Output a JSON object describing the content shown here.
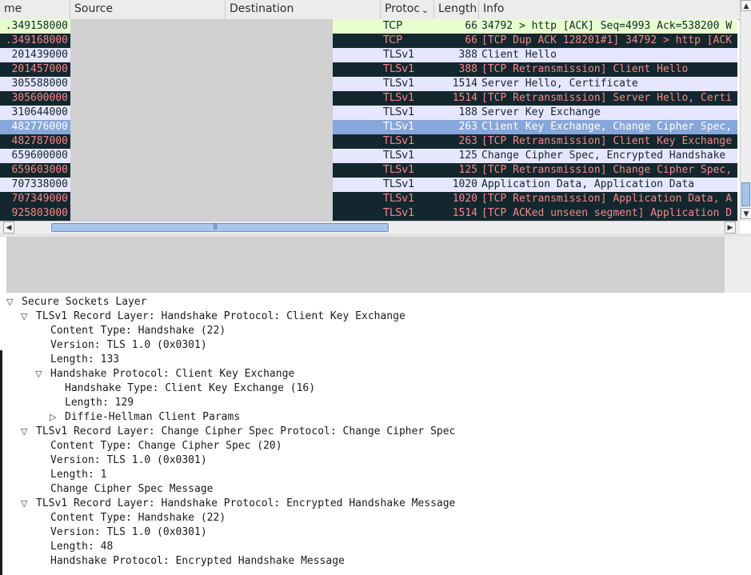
{
  "columns": [
    {
      "label": "me"
    },
    {
      "label": "Source"
    },
    {
      "label": "Destination"
    },
    {
      "label": "Protoc"
    },
    {
      "label": "Length"
    },
    {
      "label": "Info"
    }
  ],
  "packets": [
    {
      "time": ".349158000",
      "protocol": "TCP",
      "length": "66",
      "info": "34792 > http [ACK] Seq=4993 Ack=538200 W",
      "style": "tcp"
    },
    {
      "time": ".349168000",
      "protocol": "TCP",
      "length": "66",
      "info": "[TCP Dup ACK 128201#1] 34792 > http [ACK",
      "style": "tcpdup"
    },
    {
      "time": "201439000",
      "protocol": "TLSv1",
      "length": "388",
      "info": "Client Hello",
      "style": "tls"
    },
    {
      "time": "201457000",
      "protocol": "TLSv1",
      "length": "388",
      "info": "[TCP Retransmission] Client Hello",
      "style": "retrans"
    },
    {
      "time": "305588000",
      "protocol": "TLSv1",
      "length": "1514",
      "info": "Server Hello, Certificate",
      "style": "tls"
    },
    {
      "time": "305600000",
      "protocol": "TLSv1",
      "length": "1514",
      "info": "[TCP Retransmission] Server Hello, Certi",
      "style": "retrans"
    },
    {
      "time": "310644000",
      "protocol": "TLSv1",
      "length": "188",
      "info": "Server Key Exchange",
      "style": "tls"
    },
    {
      "time": "482776000",
      "protocol": "TLSv1",
      "length": "263",
      "info": "Client Key Exchange, Change Cipher Spec,",
      "style": "sel"
    },
    {
      "time": "482787000",
      "protocol": "TLSv1",
      "length": "263",
      "info": "[TCP Retransmission] Client Key Exchange",
      "style": "retrans"
    },
    {
      "time": "659600000",
      "protocol": "TLSv1",
      "length": "125",
      "info": "Change Cipher Spec, Encrypted Handshake",
      "style": "tls"
    },
    {
      "time": "659603000",
      "protocol": "TLSv1",
      "length": "125",
      "info": "[TCP Retransmission] Change Cipher Spec,",
      "style": "retrans"
    },
    {
      "time": "707338000",
      "protocol": "TLSv1",
      "length": "1020",
      "info": "Application Data, Application Data",
      "style": "tls"
    },
    {
      "time": "707349000",
      "protocol": "TLSv1",
      "length": "1020",
      "info": "[TCP Retransmission] Application Data, A",
      "style": "retrans"
    },
    {
      "time": "925803000",
      "protocol": "TLSv1",
      "length": "1514",
      "info": "[TCP ACKed unseen segment] Application D",
      "style": "retrans"
    }
  ],
  "details": [
    {
      "text": "Secure Sockets Layer",
      "level": 0,
      "toggle": "expanded"
    },
    {
      "text": "TLSv1 Record Layer: Handshake Protocol: Client Key Exchange",
      "level": 1,
      "toggle": "expanded"
    },
    {
      "text": "Content Type: Handshake (22)",
      "level": 2,
      "toggle": "none"
    },
    {
      "text": "Version: TLS 1.0 (0x0301)",
      "level": 2,
      "toggle": "none"
    },
    {
      "text": "Length: 133",
      "level": 2,
      "toggle": "none"
    },
    {
      "text": "Handshake Protocol: Client Key Exchange",
      "level": 2,
      "toggle": "expanded"
    },
    {
      "text": "Handshake Type: Client Key Exchange (16)",
      "level": 3,
      "toggle": "none"
    },
    {
      "text": "Length: 129",
      "level": 3,
      "toggle": "none"
    },
    {
      "text": "Diffie-Hellman Client Params",
      "level": 3,
      "toggle": "collapsed"
    },
    {
      "text": "TLSv1 Record Layer: Change Cipher Spec Protocol: Change Cipher Spec",
      "level": 1,
      "toggle": "expanded"
    },
    {
      "text": "Content Type: Change Cipher Spec (20)",
      "level": 2,
      "toggle": "none"
    },
    {
      "text": "Version: TLS 1.0 (0x0301)",
      "level": 2,
      "toggle": "none"
    },
    {
      "text": "Length: 1",
      "level": 2,
      "toggle": "none"
    },
    {
      "text": "Change Cipher Spec Message",
      "level": 2,
      "toggle": "none"
    },
    {
      "text": "TLSv1 Record Layer: Handshake Protocol: Encrypted Handshake Message",
      "level": 1,
      "toggle": "expanded"
    },
    {
      "text": "Content Type: Handshake (22)",
      "level": 2,
      "toggle": "none"
    },
    {
      "text": "Version: TLS 1.0 (0x0301)",
      "level": 2,
      "toggle": "none"
    },
    {
      "text": "Length: 48",
      "level": 2,
      "toggle": "none"
    },
    {
      "text": "Handshake Protocol: Encrypted Handshake Message",
      "level": 2,
      "toggle": "none"
    }
  ],
  "icons": {
    "sort_dropdown": "chevron-down-icon",
    "scroll_up": "arrow-up-icon",
    "scroll_down": "arrow-down-icon",
    "scroll_left": "arrow-left-icon",
    "scroll_right": "arrow-right-icon",
    "expanded": "triangle-down-icon",
    "collapsed": "triangle-right-icon"
  },
  "colors": {
    "tcp_row_bg": "#e7ffcf",
    "tls_row_bg": "#e7e6ff",
    "bad_row_bg": "#12272e",
    "bad_row_fg": "#f78787",
    "selected_row_bg": "#87a6d9"
  }
}
